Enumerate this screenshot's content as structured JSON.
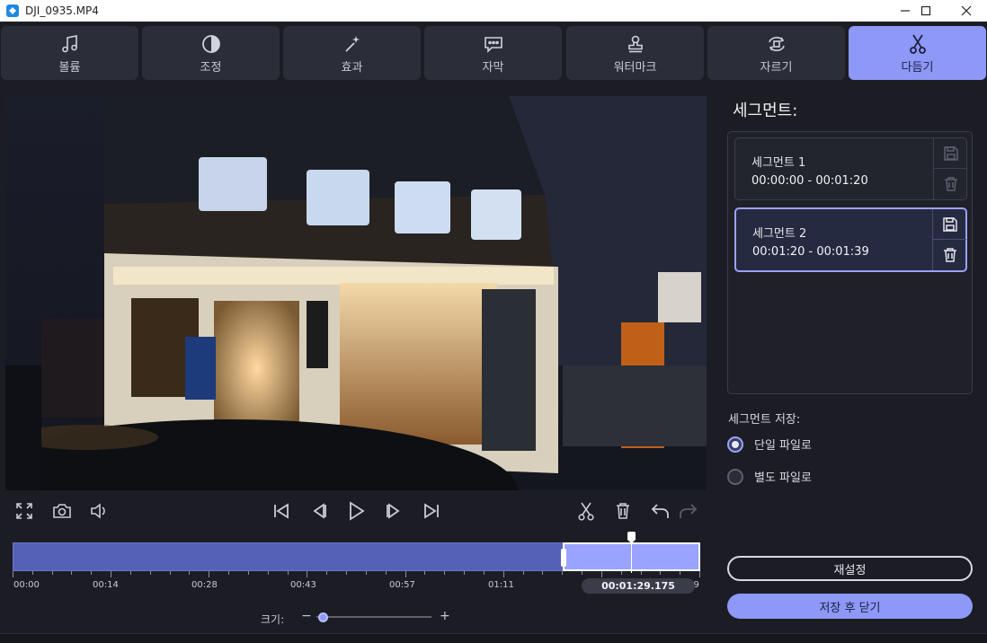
{
  "window": {
    "title": "DJI_0935.MP4",
    "minimize": "—",
    "maximize": "☐",
    "close": "✕"
  },
  "tabs": [
    {
      "label": "볼륨",
      "icon": "music-note-icon"
    },
    {
      "label": "조정",
      "icon": "contrast-icon"
    },
    {
      "label": "효과",
      "icon": "magic-wand-icon"
    },
    {
      "label": "자막",
      "icon": "speech-bubble-icon"
    },
    {
      "label": "워터마크",
      "icon": "stamp-icon"
    },
    {
      "label": "자르기",
      "icon": "crop-rotate-icon"
    },
    {
      "label": "다듬기",
      "icon": "scissors-icon",
      "active": true
    }
  ],
  "player": {
    "icons": [
      "fullscreen-icon",
      "camera-icon",
      "volume-icon",
      "skip-to-start-icon",
      "previous-frame-icon",
      "play-icon",
      "next-frame-icon",
      "skip-to-end-icon",
      "scissors-icon",
      "trash-icon",
      "undo-icon",
      "redo-icon"
    ]
  },
  "timeline": {
    "labels": [
      "00:00",
      "00:14",
      "00:28",
      "00:43",
      "00:57",
      "01:11",
      "01:39"
    ],
    "current_time": "00:01:29.175",
    "segment_split_fraction": 0.8,
    "playhead_fraction": 0.9
  },
  "zoom": {
    "label": "크기:",
    "minus": "−",
    "plus": "+",
    "level_fraction": 0.05
  },
  "panel": {
    "title": "세그먼트:",
    "segments": [
      {
        "name": "세그먼트 1",
        "range": "00:00:00 - 00:01:20",
        "selected": false
      },
      {
        "name": "세그먼트 2",
        "range": "00:01:20 - 00:01:39",
        "selected": true
      }
    ],
    "save_label": "세그먼트 저장:",
    "options": [
      {
        "label": "단일 파일로",
        "checked": true
      },
      {
        "label": "별도 파일로",
        "checked": false
      }
    ],
    "reset_label": "재설정",
    "save_close_label": "저장 후 닫기"
  },
  "colors": {
    "accent": "#8d98f7",
    "timeline_fill": "#5560b7",
    "selected_segment": "#9aa3ff",
    "background": "#1c1d24"
  }
}
